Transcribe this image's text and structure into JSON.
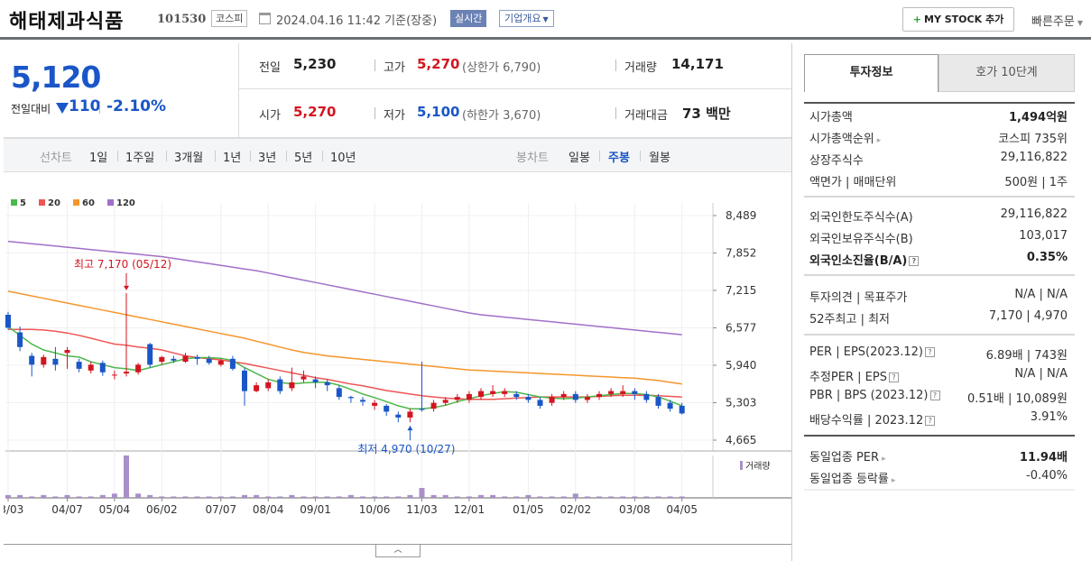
{
  "header": {
    "company_name": "해태제과식품",
    "code": "101530",
    "market": "코스피",
    "datetime": "2024.04.16 11:42",
    "basis": "기준(장중)",
    "realtime_label": "실시간",
    "company_info_label": "기업개요",
    "mystock_label": "MY STOCK 추가",
    "quick_order_label": "빠른주문"
  },
  "price": {
    "current": "5,120",
    "change_label": "전일대비",
    "change": "110",
    "change_pct": "-2.10%"
  },
  "quotes": {
    "prev_label": "전일",
    "prev": "5,230",
    "high_label": "고가",
    "high": "5,270",
    "upper_limit": "(상한가 6,790)",
    "volume_label": "거래량",
    "volume": "14,171",
    "open_label": "시가",
    "open": "5,270",
    "low_label": "저가",
    "low": "5,100",
    "lower_limit": "(하한가 3,670)",
    "amount_label": "거래대금",
    "amount": "73 백만"
  },
  "period_bar": {
    "line_label": "선차트",
    "line_periods": [
      "1일",
      "1주일",
      "3개월",
      "1년",
      "3년",
      "5년",
      "10년"
    ],
    "candle_label": "봉차트",
    "candle_periods": [
      "일봉",
      "주봉",
      "월봉"
    ],
    "selected_candle": "주봉"
  },
  "colors": {
    "up": "#d3151f",
    "down": "#1a56c7",
    "ma5": "#4cb84c",
    "ma20": "#ee5555",
    "ma60": "#f5962d",
    "ma120": "#a070c8",
    "volume": "#a98fc9"
  },
  "chart_data": {
    "type": "candlestick",
    "legend": [
      "5",
      "20",
      "60",
      "120"
    ],
    "y_ticks": [
      "8,489",
      "7,852",
      "7,215",
      "6,577",
      "5,940",
      "5,303",
      "4,665"
    ],
    "ylim": [
      4665,
      8489
    ],
    "x_ticks": [
      "03/03",
      "04/07",
      "05/04",
      "06/02",
      "07/07",
      "08/04",
      "09/01",
      "10/06",
      "11/03",
      "12/01",
      "01/05",
      "02/02",
      "03/08",
      "04/05"
    ],
    "x_tick_index": [
      0,
      5,
      9,
      13,
      18,
      22,
      26,
      31,
      35,
      39,
      44,
      48,
      53,
      57
    ],
    "high_annotation": "최고 7,170 (05/12)",
    "high_index": 10,
    "high_value": 7170,
    "low_annotation": "최저 4,970 (10/27)",
    "low_index": 34,
    "low_value": 4970,
    "volume_legend": "거래량",
    "candles": [
      [
        6800,
        6850,
        6550,
        6580
      ],
      [
        6500,
        6600,
        6180,
        6250
      ],
      [
        6100,
        6150,
        5750,
        5950
      ],
      [
        5950,
        6120,
        5900,
        6080
      ],
      [
        6050,
        6250,
        5850,
        5950
      ],
      [
        6150,
        6250,
        5880,
        6200
      ],
      [
        6000,
        6050,
        5820,
        5880
      ],
      [
        5850,
        6000,
        5800,
        5950
      ],
      [
        5980,
        6020,
        5760,
        5820
      ],
      [
        5780,
        5850,
        5700,
        5780
      ],
      [
        5800,
        7170,
        5750,
        5830
      ],
      [
        5820,
        5980,
        5780,
        5950
      ],
      [
        6300,
        6320,
        5900,
        5950
      ],
      [
        6000,
        6100,
        5950,
        6080
      ],
      [
        6050,
        6100,
        5980,
        6020
      ],
      [
        6000,
        6150,
        5980,
        6100
      ],
      [
        6080,
        6120,
        5950,
        6050
      ],
      [
        6050,
        6100,
        5950,
        5980
      ],
      [
        5950,
        6050,
        5920,
        6020
      ],
      [
        6050,
        6100,
        5850,
        5880
      ],
      [
        5850,
        5900,
        5250,
        5500
      ],
      [
        5500,
        5650,
        5480,
        5600
      ],
      [
        5550,
        5700,
        5500,
        5650
      ],
      [
        5700,
        5750,
        5450,
        5500
      ],
      [
        5550,
        5900,
        5500,
        5650
      ],
      [
        5700,
        5850,
        5650,
        5750
      ],
      [
        5700,
        5750,
        5550,
        5650
      ],
      [
        5650,
        5700,
        5500,
        5600
      ],
      [
        5550,
        5600,
        5350,
        5400
      ],
      [
        5400,
        5420,
        5300,
        5380
      ],
      [
        5350,
        5400,
        5250,
        5320
      ],
      [
        5250,
        5350,
        5180,
        5300
      ],
      [
        5250,
        5280,
        5080,
        5150
      ],
      [
        5100,
        5150,
        4970,
        5050
      ],
      [
        5050,
        5200,
        4970,
        5150
      ],
      [
        5200,
        6000,
        5150,
        5180
      ],
      [
        5200,
        5350,
        5150,
        5300
      ],
      [
        5300,
        5400,
        5250,
        5350
      ],
      [
        5350,
        5450,
        5300,
        5400
      ],
      [
        5350,
        5500,
        5300,
        5450
      ],
      [
        5400,
        5550,
        5350,
        5500
      ],
      [
        5450,
        5600,
        5400,
        5500
      ],
      [
        5450,
        5550,
        5400,
        5500
      ],
      [
        5450,
        5500,
        5350,
        5400
      ],
      [
        5400,
        5450,
        5300,
        5350
      ],
      [
        5350,
        5400,
        5200,
        5250
      ],
      [
        5300,
        5450,
        5250,
        5400
      ],
      [
        5400,
        5500,
        5350,
        5450
      ],
      [
        5450,
        5500,
        5300,
        5350
      ],
      [
        5350,
        5450,
        5300,
        5400
      ],
      [
        5400,
        5500,
        5350,
        5450
      ],
      [
        5450,
        5550,
        5400,
        5500
      ],
      [
        5450,
        5600,
        5400,
        5500
      ],
      [
        5500,
        5550,
        5350,
        5450
      ],
      [
        5450,
        5500,
        5300,
        5350
      ],
      [
        5400,
        5450,
        5200,
        5250
      ],
      [
        5300,
        5350,
        5150,
        5200
      ],
      [
        5250,
        5300,
        5100,
        5120
      ]
    ],
    "ma5": [
      6600,
      6450,
      6300,
      6200,
      6150,
      6100,
      6080,
      6000,
      5950,
      5900,
      5880,
      5850,
      5900,
      5950,
      6000,
      6050,
      6070,
      6070,
      6060,
      6020,
      5900,
      5800,
      5700,
      5650,
      5620,
      5640,
      5650,
      5650,
      5600,
      5530,
      5450,
      5390,
      5320,
      5250,
      5200,
      5200,
      5220,
      5260,
      5320,
      5370,
      5420,
      5460,
      5490,
      5480,
      5440,
      5400,
      5380,
      5370,
      5380,
      5400,
      5420,
      5440,
      5460,
      5460,
      5440,
      5400,
      5330,
      5250
    ],
    "ma20": [
      6550,
      6550,
      6550,
      6540,
      6520,
      6490,
      6450,
      6400,
      6350,
      6300,
      6280,
      6250,
      6230,
      6200,
      6150,
      6100,
      6070,
      6050,
      6030,
      6000,
      5970,
      5930,
      5890,
      5850,
      5810,
      5770,
      5730,
      5700,
      5660,
      5620,
      5590,
      5550,
      5510,
      5480,
      5450,
      5420,
      5400,
      5380,
      5370,
      5360,
      5360,
      5360,
      5370,
      5380,
      5390,
      5400,
      5400,
      5400,
      5400,
      5400,
      5410,
      5420,
      5430,
      5430,
      5430,
      5420,
      5410,
      5400
    ],
    "ma60": [
      7200,
      7160,
      7120,
      7080,
      7040,
      7000,
      6960,
      6920,
      6880,
      6840,
      6800,
      6760,
      6720,
      6680,
      6640,
      6600,
      6560,
      6520,
      6480,
      6440,
      6400,
      6350,
      6300,
      6250,
      6200,
      6160,
      6130,
      6100,
      6080,
      6060,
      6040,
      6020,
      6000,
      5980,
      5960,
      5940,
      5920,
      5900,
      5880,
      5860,
      5850,
      5840,
      5830,
      5820,
      5810,
      5800,
      5790,
      5780,
      5770,
      5760,
      5750,
      5740,
      5730,
      5720,
      5700,
      5680,
      5650,
      5620
    ],
    "ma120": [
      8050,
      8030,
      8010,
      7990,
      7970,
      7950,
      7930,
      7910,
      7890,
      7870,
      7850,
      7830,
      7810,
      7790,
      7760,
      7730,
      7700,
      7670,
      7640,
      7610,
      7580,
      7550,
      7510,
      7470,
      7430,
      7390,
      7350,
      7310,
      7270,
      7230,
      7190,
      7150,
      7110,
      7070,
      7030,
      6990,
      6950,
      6910,
      6870,
      6830,
      6800,
      6780,
      6760,
      6740,
      6720,
      6700,
      6680,
      6660,
      6640,
      6620,
      6600,
      6580,
      6560,
      6540,
      6520,
      6500,
      6480,
      6460
    ],
    "volume": [
      2,
      2,
      1,
      2,
      1,
      2,
      1,
      1,
      2,
      3,
      30,
      3,
      2,
      1,
      1,
      1,
      1,
      1,
      1,
      1,
      2,
      2,
      1,
      1,
      2,
      1,
      1,
      1,
      1,
      2,
      1,
      1,
      1,
      1,
      2,
      7,
      2,
      2,
      1,
      1,
      2,
      2,
      1,
      1,
      2,
      1,
      1,
      1,
      3,
      1,
      1,
      1,
      1,
      1,
      1,
      1,
      1,
      1
    ]
  },
  "right_panel": {
    "tab_active": "투자정보",
    "tab_inactive": "호가 10단계",
    "market_cap_label": "시가총액",
    "market_cap": "1,494억원",
    "market_cap_rank_label": "시가총액순위",
    "market_cap_rank": "코스피 735위",
    "shares_label": "상장주식수",
    "shares": "29,116,822",
    "par_label": "액면가",
    "unit_label": "매매단위",
    "par_value": "500원",
    "unit_value": "1주",
    "foreign_limit_label": "외국인한도주식수(A)",
    "foreign_limit": "29,116,822",
    "foreign_hold_label": "외국인보유주식수(B)",
    "foreign_hold": "103,017",
    "foreign_ratio_label": "외국인소진율(B/A)",
    "foreign_ratio": "0.35%",
    "opinion_label": "투자의견",
    "target_label": "목표주가",
    "opinion": "N/A",
    "target": "N/A",
    "w52_high_label": "52주최고",
    "w52_low_label": "최저",
    "w52_high": "7,170",
    "w52_low": "4,970",
    "per_label": "PER",
    "eps_label": "EPS(2023.12)",
    "per": "6.89배",
    "eps": "743원",
    "est_per_label": "추정PER",
    "est_eps_label": "EPS",
    "est_per": "N/A",
    "est_eps": "N/A",
    "pbr_label": "PBR",
    "bps_label": "BPS (2023.12)",
    "pbr": "0.51배",
    "bps": "10,089원",
    "div_label": "배당수익률",
    "div_date": "2023.12",
    "div": "3.91%",
    "peer_per_label": "동일업종 PER",
    "peer_per": "11.94배",
    "peer_rate_label": "동일업종 등락률",
    "peer_rate": "-0.40%"
  }
}
